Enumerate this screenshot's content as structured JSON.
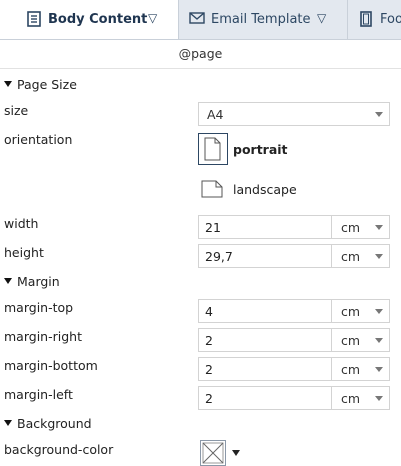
{
  "tabs": [
    {
      "label": "Body Content",
      "icon": "document-icon",
      "active": true
    },
    {
      "label": "Email Template",
      "icon": "envelope-icon",
      "active": false
    },
    {
      "label": "Foo",
      "icon": "page-icon",
      "active": false
    }
  ],
  "subheader": "@page",
  "sections": {
    "page_size": "Page Size",
    "margin": "Margin",
    "background": "Background"
  },
  "fields": {
    "size_label": "size",
    "size_value": "A4",
    "orientation_label": "orientation",
    "portrait": "portrait",
    "landscape": "landscape",
    "width_label": "width",
    "width_value": "21",
    "width_unit": "cm",
    "height_label": "height",
    "height_value": "29,7",
    "height_unit": "cm",
    "margin_top_label": "margin-top",
    "margin_top_value": "4",
    "margin_top_unit": "cm",
    "margin_right_label": "margin-right",
    "margin_right_value": "2",
    "margin_right_unit": "cm",
    "margin_bottom_label": "margin-bottom",
    "margin_bottom_value": "2",
    "margin_bottom_unit": "cm",
    "margin_left_label": "margin-left",
    "margin_left_value": "2",
    "margin_left_unit": "cm",
    "bg_color_label": "background-color"
  },
  "colors": {
    "tab_bar": "#e3e8ef",
    "tab_text": "#1f3550",
    "border": "#d3d3d3"
  }
}
